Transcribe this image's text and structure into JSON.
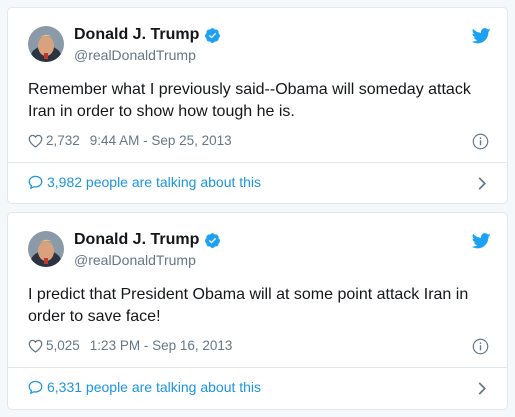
{
  "colors": {
    "accent": "#1da1f2",
    "link": "#1b95e0",
    "muted": "#657786"
  },
  "tweets": [
    {
      "display_name": "Donald J. Trump",
      "handle": "@realDonaldTrump",
      "verified_icon": "verified-badge-icon",
      "text": "Remember what I previously said--Obama will someday attack Iran in order to show how tough he is.",
      "likes": "2,732",
      "timestamp": "9:44 AM - Sep 25, 2013",
      "talking": "3,982 people are talking about this"
    },
    {
      "display_name": "Donald J. Trump",
      "handle": "@realDonaldTrump",
      "verified_icon": "verified-badge-icon",
      "text": "I predict that President Obama will at some point attack Iran in order to save face!",
      "likes": "5,025",
      "timestamp": "1:23 PM - Sep 16, 2013",
      "talking": "6,331 people are talking about this"
    }
  ]
}
